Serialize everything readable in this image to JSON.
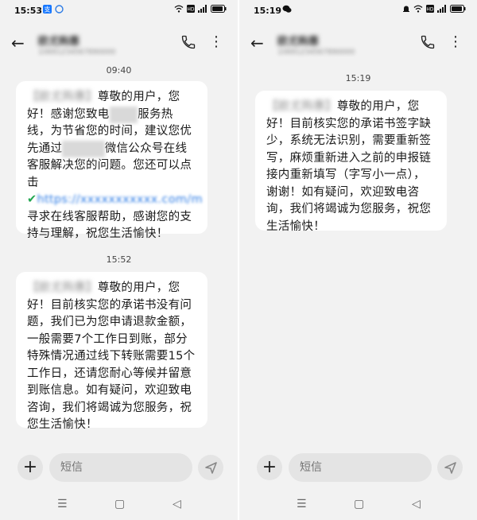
{
  "left": {
    "status": {
      "time": "15:53"
    },
    "header": {
      "name": "欧尤购惠",
      "number": "10691234567890000"
    },
    "messages": [
      {
        "timestamp": "09:40",
        "sender_tag": "【欧尤购惠】",
        "p1": "尊敬的用户，您好！感谢您致电",
        "p2": "服务热线，为节省您的时间，建议您优先通过",
        "p3": "微信公众号在线客服解决您的问题。您还可以点击",
        "link": "https://xxxxxxxxxxx.com/m",
        "p4": "寻求在线客服帮助，感谢您的支持与理解，祝您生活愉快！"
      },
      {
        "timestamp": "15:52",
        "sender_tag": "【欧尤购惠】",
        "body": "尊敬的用户，您好！目前核实您的承诺书没有问题，我们已为您申请退款金额，一般需要7个工作日到账，部分特殊情况通过线下转账需要15个工作日，还请您耐心等候并留意到账信息。如有疑问，欢迎致电咨询，我们将竭诚为您服务，祝您生活愉快！"
      }
    ],
    "composer": {
      "placeholder": "短信"
    }
  },
  "right": {
    "status": {
      "time": "15:19"
    },
    "header": {
      "name": "欧尤购惠",
      "number": "10691234567890000"
    },
    "messages": [
      {
        "timestamp": "15:19",
        "sender_tag": "【欧尤购惠】",
        "body": "尊敬的用户，您好！目前核实您的承诺书签字缺少，系统无法识别，需要重新签写，麻烦重新进入之前的申报链接内重新填写（字写小一点），谢谢！如有疑问，欢迎致电咨询，我们将竭诚为您服务，祝您生活愉快！"
      }
    ],
    "composer": {
      "placeholder": "短信"
    }
  },
  "icons": {
    "back": "arrow-left-icon",
    "call": "phone-icon",
    "more": "more-vertical-icon",
    "add": "plus-icon",
    "send": "send-icon",
    "nav": [
      "menu-icon",
      "home-icon",
      "back-triangle-icon"
    ]
  },
  "colors": {
    "background": "#f2f2f2",
    "bubble": "#ffffff",
    "link": "#2c7be5",
    "shield": "#22a650"
  }
}
